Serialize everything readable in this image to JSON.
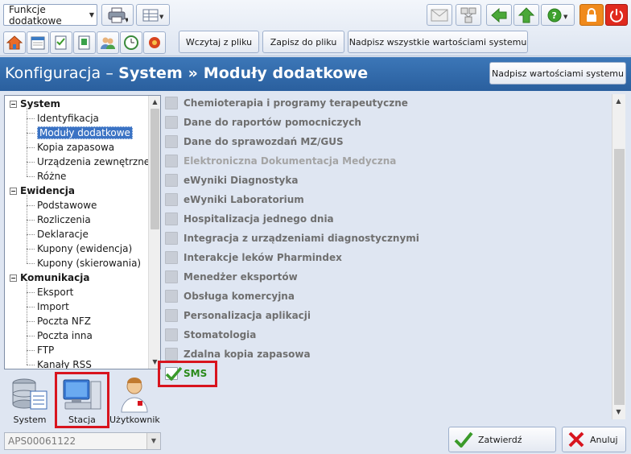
{
  "toolbar": {
    "function_combo": "Funkcje dodatkowe",
    "load_button": "Wczytaj z pliku",
    "save_button": "Zapisz do pliku",
    "overwrite_all_button": "Nadpisz wszystkie wartościami systemu"
  },
  "header": {
    "title_prefix": "Konfiguracja – ",
    "title_main": "System » Moduły dodatkowe",
    "restore_button": "Nadpisz wartościami systemu"
  },
  "tree": {
    "groups": [
      {
        "label": "System",
        "items": [
          "Identyfikacja",
          "Moduły dodatkowe",
          "Kopia zapasowa",
          "Urządzenia zewnętrzne",
          "Różne"
        ]
      },
      {
        "label": "Ewidencja",
        "items": [
          "Podstawowe",
          "Rozliczenia",
          "Deklaracje",
          "Kupony (ewidencja)",
          "Kupony (skierowania)"
        ]
      },
      {
        "label": "Komunikacja",
        "items": [
          "Eksport",
          "Import",
          "Poczta NFZ",
          "Poczta inna",
          "FTP",
          "Kanały RSS"
        ]
      }
    ],
    "selected": "Moduły dodatkowe"
  },
  "modules": [
    {
      "label": "Chemioterapia i programy terapeutyczne",
      "state": "off"
    },
    {
      "label": "Dane do raportów pomocniczych",
      "state": "off"
    },
    {
      "label": "Dane do sprawozdań MZ/GUS",
      "state": "off"
    },
    {
      "label": "Elektroniczna Dokumentacja Medyczna",
      "state": "dim"
    },
    {
      "label": "eWyniki Diagnostyka",
      "state": "off"
    },
    {
      "label": "eWyniki Laboratorium",
      "state": "off"
    },
    {
      "label": "Hospitalizacja jednego dnia",
      "state": "off"
    },
    {
      "label": "Integracja z urządzeniami diagnostycznymi",
      "state": "off"
    },
    {
      "label": "Interakcje leków Pharmindex",
      "state": "off"
    },
    {
      "label": "Menedżer eksportów",
      "state": "off"
    },
    {
      "label": "Obsługa komercyjna",
      "state": "off"
    },
    {
      "label": "Personalizacja aplikacji",
      "state": "off"
    },
    {
      "label": "Stomatologia",
      "state": "off"
    },
    {
      "label": "Zdalna kopia zapasowa",
      "state": "off"
    },
    {
      "label": "SMS",
      "state": "on"
    }
  ],
  "scope": {
    "system_label": "System",
    "station_label": "Stacja",
    "user_label": "Użytkownik",
    "station_value": "APS00061122"
  },
  "actions": {
    "confirm": "Zatwierdź",
    "cancel": "Anuluj"
  },
  "colors": {
    "accent": "#2a5f9e",
    "highlight": "#d8141e",
    "check": "#2a8a1a"
  }
}
